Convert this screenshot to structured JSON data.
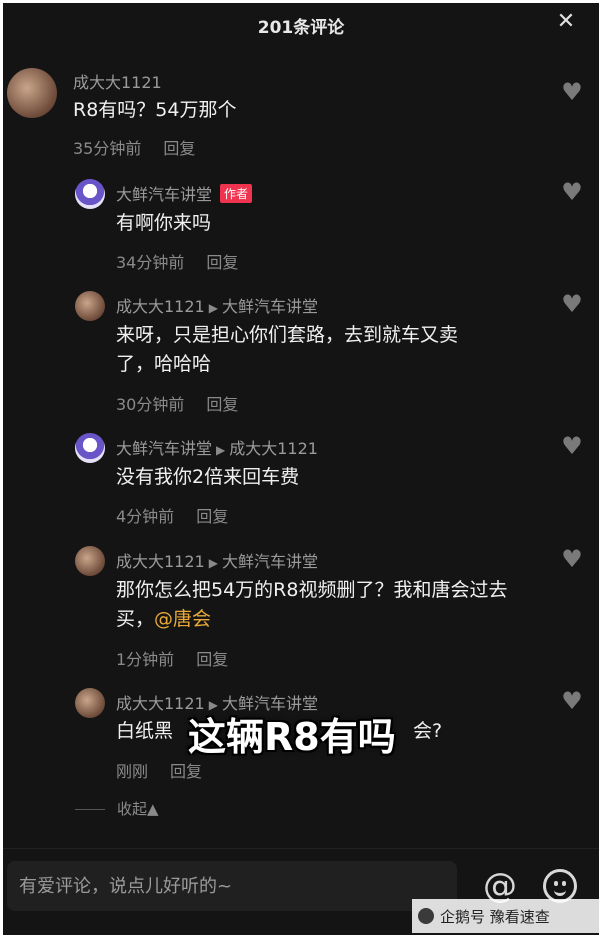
{
  "header": {
    "title": "201条评论",
    "close_icon": "close-icon"
  },
  "comments": [
    {
      "name": "成大大1121",
      "reply_to": "",
      "badge": "",
      "text": "R8有吗？54万那个",
      "time": "35分钟前",
      "reply_label": "回复"
    },
    {
      "name": "大鲜汽车讲堂",
      "reply_to": "",
      "badge": "作者",
      "text": "有啊你来吗",
      "time": "34分钟前",
      "reply_label": "回复"
    },
    {
      "name": "成大大1121",
      "reply_to": "大鲜汽车讲堂",
      "badge": "",
      "text": "来呀，只是担心你们套路，去到就车又卖了，哈哈哈",
      "time": "30分钟前",
      "reply_label": "回复"
    },
    {
      "name": "大鲜汽车讲堂",
      "reply_to": "成大大1121",
      "badge": "",
      "text": "没有我你2倍来回车费",
      "time": "4分钟前",
      "reply_label": "回复"
    },
    {
      "name": "成大大1121",
      "reply_to": "大鲜汽车讲堂",
      "badge": "",
      "text": "那你怎么把54万的R8视频删了？我和唐会过去买，",
      "mention": "@唐会",
      "time": "1分钟前",
      "reply_label": "回复"
    },
    {
      "name": "成大大1121",
      "reply_to": "大鲜汽车讲堂",
      "badge": "",
      "text_start": "白纸黑",
      "text_end": "会?",
      "time": "刚刚",
      "reply_label": "回复"
    }
  ],
  "collapse_label": "收起▲",
  "overlay_caption": "这辆R8有吗",
  "input": {
    "placeholder": "有爱评论，说点儿好听的~"
  },
  "watermark": "企鹅号 豫看速查",
  "colors": {
    "background": "#141414",
    "badge": "#f0334e",
    "mention": "#e9a93a"
  }
}
